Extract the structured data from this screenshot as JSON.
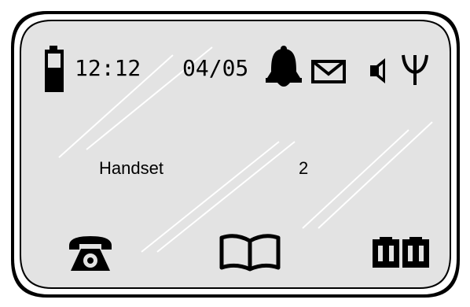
{
  "status_bar": {
    "time": "12:12",
    "date": "04/05",
    "icons": [
      "battery-icon",
      "bell-icon",
      "envelope-icon",
      "speaker-icon",
      "antenna-icon"
    ]
  },
  "main": {
    "handset_label": "Handset",
    "handset_number": "2"
  },
  "softkeys": {
    "icons": [
      "telephone-icon",
      "phonebook-icon",
      "intercom-icon"
    ]
  },
  "colors": {
    "screen_background": "#e3e3e3",
    "bezel": "#000000",
    "glyph": "#000000",
    "glare": "#ffffff"
  }
}
